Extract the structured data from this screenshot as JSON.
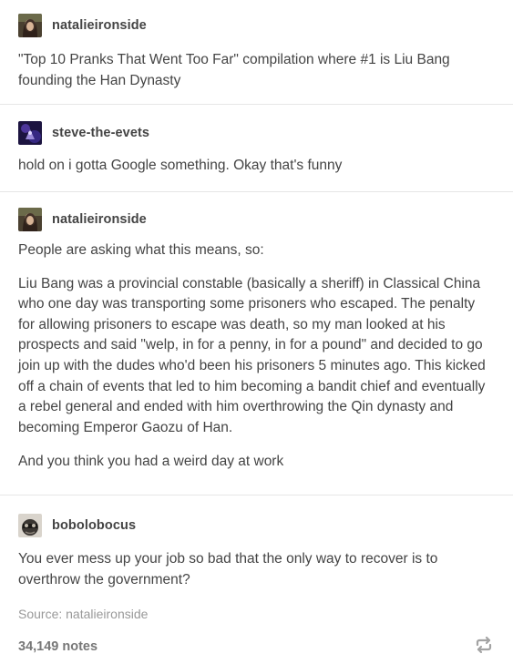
{
  "posts": [
    {
      "username": "natalieironside",
      "avatar_icon": "user-avatar-icon",
      "paragraphs": [
        "\"Top 10 Pranks That Went Too Far\" compilation where #1 is Liu Bang founding the Han Dynasty"
      ]
    },
    {
      "username": "steve-the-evets",
      "avatar_icon": "user-avatar-icon",
      "paragraphs": [
        "hold on i gotta Google something. Okay that's funny"
      ]
    },
    {
      "username": "natalieironside",
      "avatar_icon": "user-avatar-icon",
      "paragraphs": [
        "People are asking what this means, so:",
        "Liu Bang was a provincial constable (basically a sheriff) in Classical China who one day was transporting some prisoners who escaped. The penalty for allowing prisoners to escape was death, so my man looked at his prospects and said \"welp, in for a penny, in for a pound\" and decided to go join up with the dudes who'd been his prisoners 5 minutes ago. This kicked off a chain of events that led to him becoming a bandit chief and eventually a rebel general and ended with him overthrowing the Qin dynasty and becoming Emperor Gaozu of Han.",
        "And you think you had a weird day at work"
      ]
    },
    {
      "username": "bobolobocus",
      "avatar_icon": "user-avatar-icon",
      "paragraphs": [
        "You ever mess up your job so bad that the only way to recover is to overthrow the government?"
      ]
    }
  ],
  "footer": {
    "source": "Source: natalieironside",
    "notes": "34,149 notes",
    "reblog_icon": "reblog-icon"
  },
  "colors": {
    "text": "#444444",
    "muted": "#999999",
    "divider": "#e6e6e6"
  }
}
